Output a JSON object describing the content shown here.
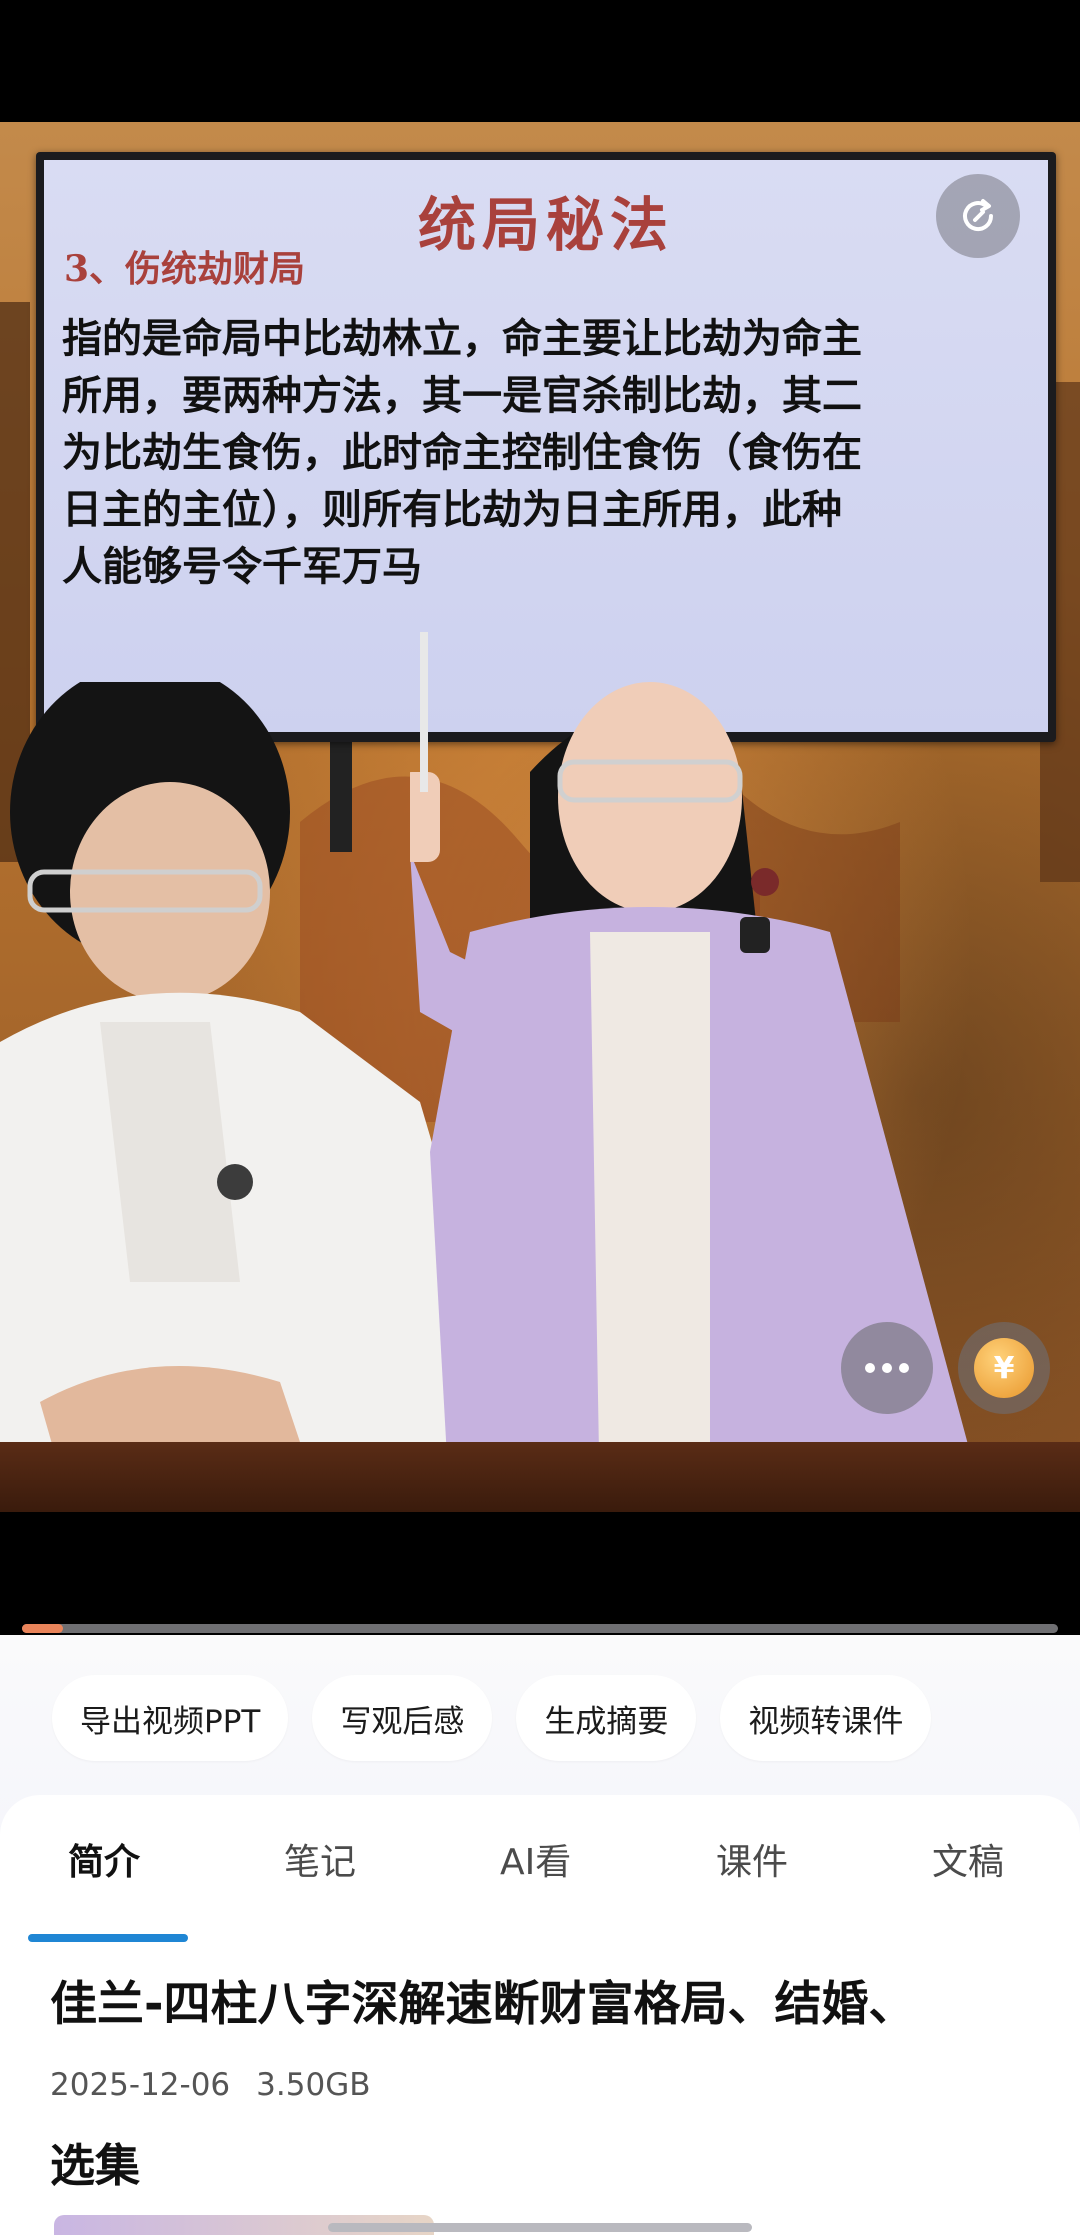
{
  "video": {
    "slide_title": "统局秘法",
    "slide_subtitle": "3、伤统劫财局",
    "slide_lines": [
      "指的是命局中比劫林立，命主要让比劫为命主",
      "所用，要两种方法，其一是官杀制比劫，其二",
      "为比劫生食伤，此时命主控制住食伤（食伤在",
      "日主的主位），则所有比劫为日主所用，此种",
      "人能够号令千军万马"
    ],
    "refresh_icon": "refresh-icon",
    "more_icon": "more-dots-icon",
    "coin_icon": "coin-icon",
    "coin_glyph": "¥",
    "progress": 0.04
  },
  "actions": [
    {
      "label": "导出视频PPT"
    },
    {
      "label": "写观后感"
    },
    {
      "label": "生成摘要"
    },
    {
      "label": "视频转课件"
    }
  ],
  "tabs": [
    {
      "label": "简介"
    },
    {
      "label": "笔记"
    },
    {
      "label": "AI看"
    },
    {
      "label": "课件"
    },
    {
      "label": "文稿"
    }
  ],
  "info": {
    "title": "佳兰-四柱八字深解速断财富格局、结婚、",
    "date": "2025-12-06",
    "size": "3.50GB",
    "section": "选集"
  },
  "colors": {
    "accent": "#1f86d4",
    "progress": "#e9845a",
    "slide_heading": "#a9413c"
  }
}
